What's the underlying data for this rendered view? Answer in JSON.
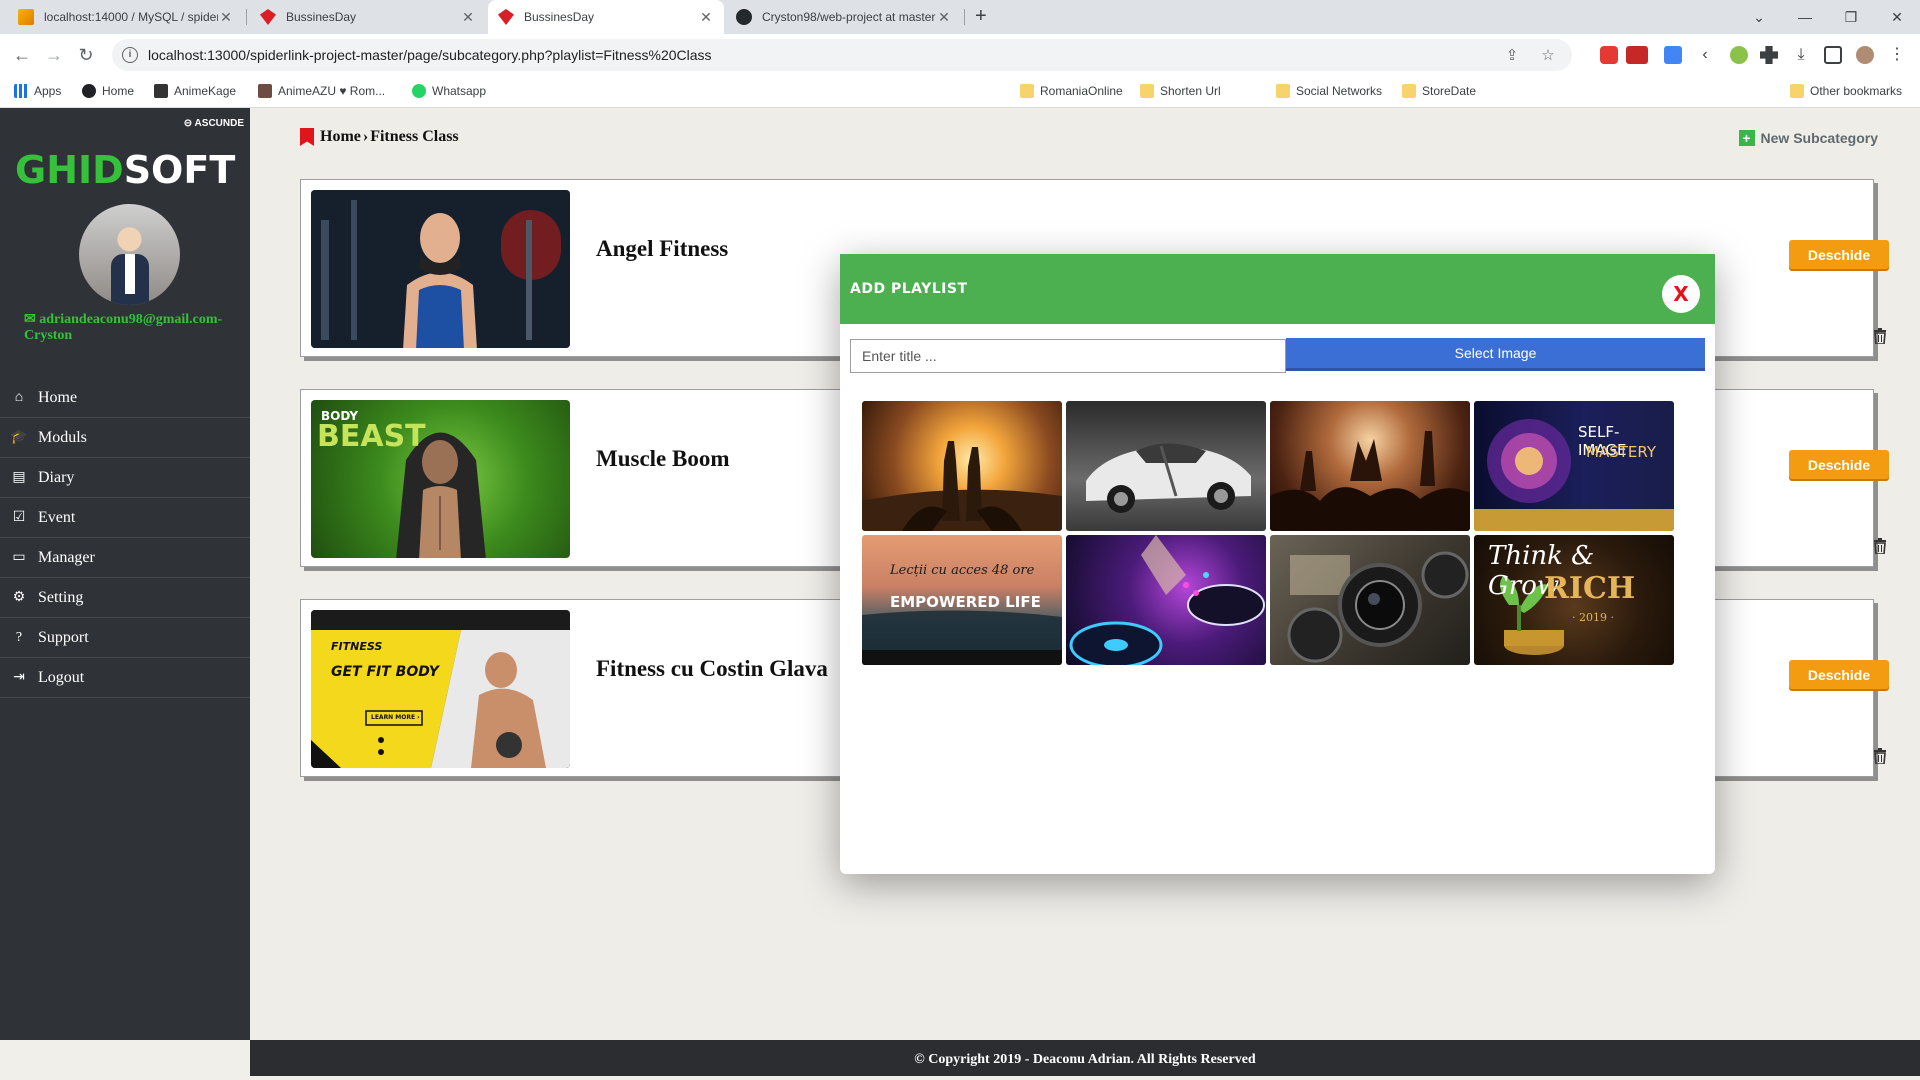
{
  "browser": {
    "tabs": [
      {
        "label": "localhost:14000 / MySQL / spider",
        "icon": "phpmyadmin-icon"
      },
      {
        "label": "BussinesDay",
        "icon": "ruby-icon"
      },
      {
        "label": "BussinesDay",
        "icon": "ruby-icon",
        "active": true
      },
      {
        "label": "Cryston98/web-project at master",
        "icon": "github-icon"
      }
    ],
    "url": "localhost:13000/spiderlink-project-master/page/subcategory.php?playlist=Fitness%20Class",
    "bookmarks": [
      "Apps",
      "Home",
      "AnimeKage",
      "AnimeAZU ♥ Rom...",
      "Whatsapp",
      "RomaniaOnline",
      "Shorten Url",
      "Social Networks",
      "StoreDate",
      "Other bookmarks"
    ]
  },
  "sidebar": {
    "hide_label": "ASCUNDE",
    "logo_part1": "GHID",
    "logo_part2": "SOFT",
    "email": "adriandeaconu98@gmail.com-Cryston",
    "menu": [
      {
        "label": "Home",
        "icon": "home-icon"
      },
      {
        "label": "Moduls",
        "icon": "graduation-cap-icon"
      },
      {
        "label": "Diary",
        "icon": "book-icon"
      },
      {
        "label": "Event",
        "icon": "calendar-check-icon"
      },
      {
        "label": "Manager",
        "icon": "folder-open-icon"
      },
      {
        "label": "Setting",
        "icon": "gears-icon"
      },
      {
        "label": "Support",
        "icon": "question-circle-icon"
      },
      {
        "label": "Logout",
        "icon": "sign-out-icon"
      }
    ]
  },
  "main": {
    "breadcrumb": {
      "home": "Home",
      "separator": "›",
      "current": "Fitness Class"
    },
    "new_subcategory_label": "New Subcategory",
    "cards": [
      {
        "title": "Angel Fitness",
        "button": "Deschide"
      },
      {
        "title": "Muscle Boom",
        "button": "Deschide"
      },
      {
        "title": "Fitness cu Costin Glava",
        "button": "Deschide"
      }
    ],
    "thumb_texts": {
      "body": "BODY",
      "beast": "BEAST",
      "fitness": "FITNESS",
      "get_fit": "GET FIT BODY",
      "learn": "LEARN MORE ›"
    }
  },
  "modal": {
    "title": "ADD PLAYLIST",
    "close_label": "X",
    "title_placeholder": "Enter title ...",
    "select_image_label": "Select Image",
    "images": [
      {
        "name": "beer-sunset-image"
      },
      {
        "name": "white-sportscar-image"
      },
      {
        "name": "concert-crowd-image"
      },
      {
        "name": "self-image-mastery-image",
        "caption1": "SELF-IMAGE",
        "caption2": "MASTERY"
      },
      {
        "name": "empowered-life-image",
        "caption1": "Lecții cu acces 48 ore",
        "caption2": "EMPOWERED LIFE"
      },
      {
        "name": "dj-turntable-image"
      },
      {
        "name": "camera-lenses-image"
      },
      {
        "name": "think-grow-rich-image",
        "caption1": "Think & Grow",
        "caption2": "RICH",
        "caption3": "· 2019 ·"
      }
    ]
  },
  "footer": {
    "text": "© Copyright 2019 - Deaconu Adrian. All Rights Reserved"
  }
}
